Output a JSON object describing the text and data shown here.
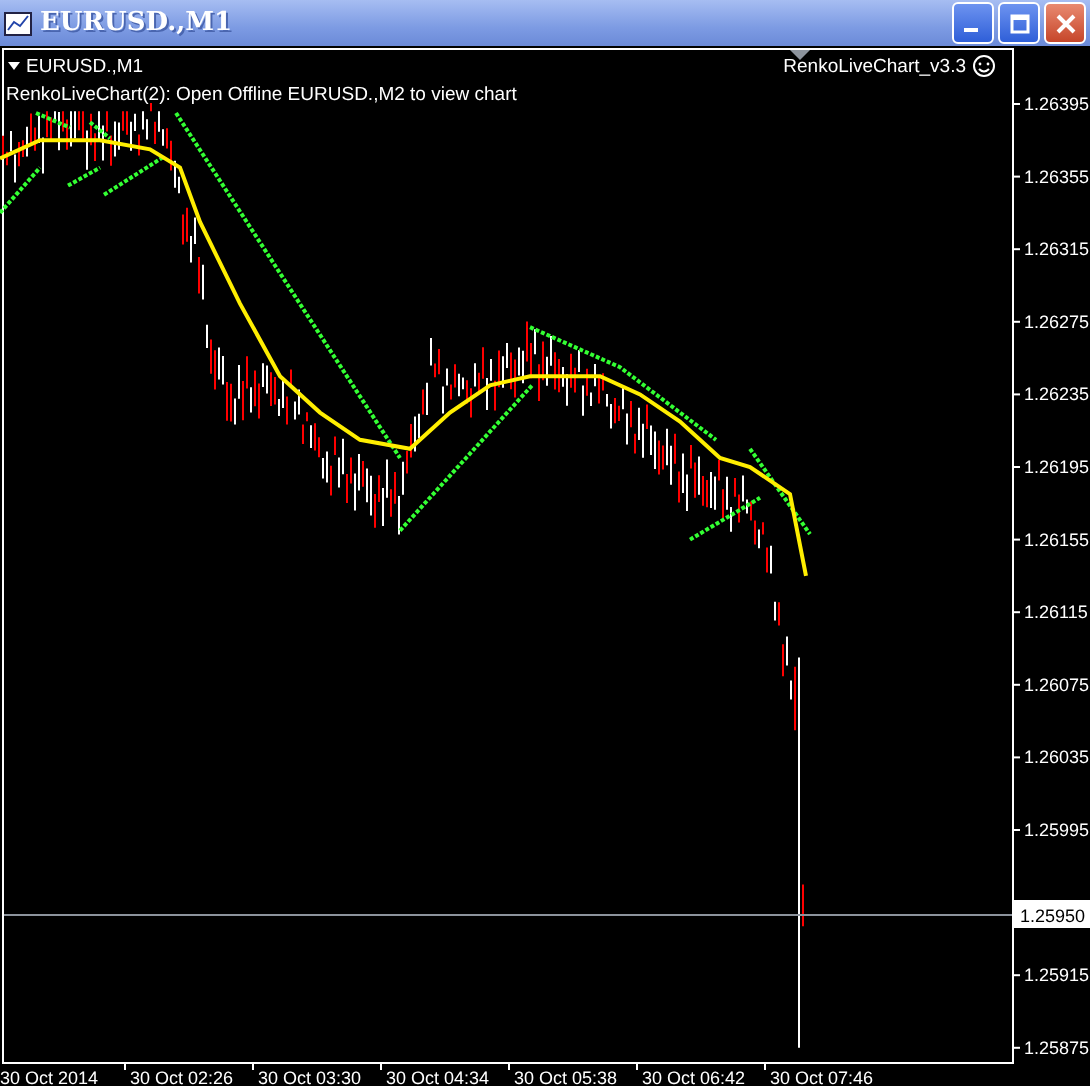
{
  "window": {
    "title": "EURUSD.,M1"
  },
  "chart": {
    "symbol_label": "EURUSD.,M1",
    "indicator_name": "RenkoLiveChart_v3.3",
    "message": "RenkoLiveChart(2): Open Offline EURUSD.,M2 to view chart",
    "price_axis_upper": [
      "1.26395",
      "1.26355",
      "1.26315",
      "1.26275",
      "1.26235",
      "1.26195",
      "1.26155",
      "1.26115",
      "1.26075",
      "1.26035",
      "1.25995"
    ],
    "price_axis_lower": [
      "1.25915",
      "1.25875"
    ],
    "current_price": "1.25950",
    "time_axis": [
      "30 Oct 2014",
      "30 Oct 02:26",
      "30 Oct 03:30",
      "30 Oct 04:34",
      "30 Oct 05:38",
      "30 Oct 06:42",
      "30 Oct 07:46"
    ]
  }
}
